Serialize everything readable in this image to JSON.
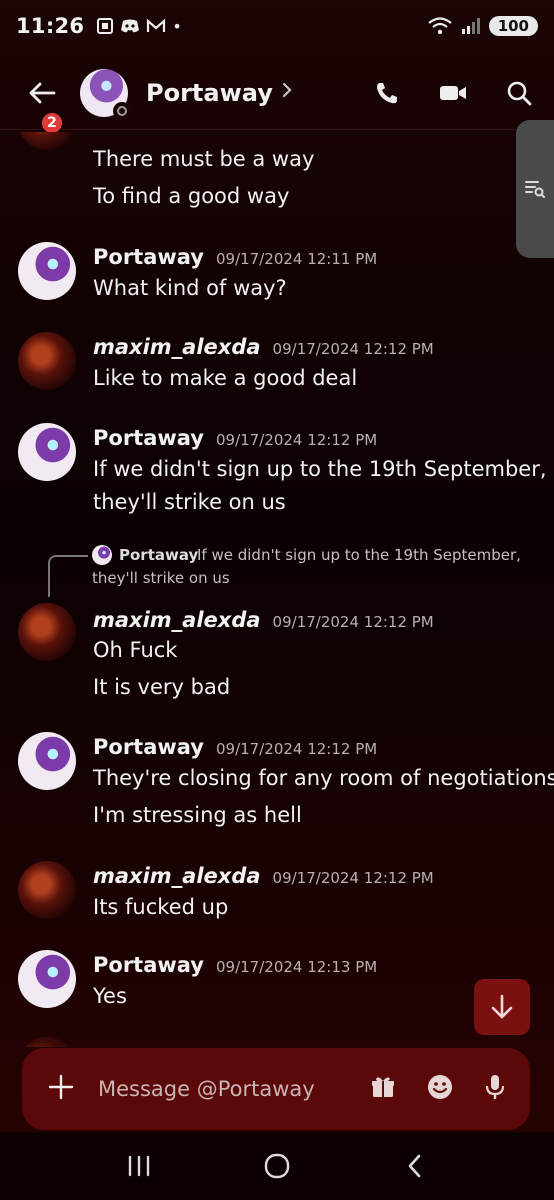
{
  "status": {
    "time": "11:26",
    "battery": "100",
    "network": "6"
  },
  "header": {
    "title": "Portaway",
    "unread_badge": "2"
  },
  "messages": [
    {
      "type": "continuation",
      "lines": [
        "There must be a way",
        "To find a good way"
      ]
    },
    {
      "author": "Portaway",
      "timestamp": "09/17/2024 12:11 PM",
      "lines": [
        "What kind of way?"
      ]
    },
    {
      "author": "maxim_alexda",
      "timestamp": "09/17/2024 12:12 PM",
      "lines": [
        "Like to make a good deal"
      ]
    },
    {
      "author": "Portaway",
      "timestamp": "09/17/2024 12:12 PM",
      "lines": [
        "If we didn't sign up to the 19th September,",
        "they'll strike on us"
      ]
    },
    {
      "author": "maxim_alexda",
      "timestamp": "09/17/2024 12:12 PM",
      "reply": {
        "author": "Portaway",
        "text_line1": "If we didn't sign up to the 19th September,",
        "text_line2": "they'll strike on us"
      },
      "lines": [
        "Oh Fuck",
        "It is very bad"
      ]
    },
    {
      "author": "Portaway",
      "timestamp": "09/17/2024 12:12 PM",
      "lines": [
        "They're closing for any room of negotiations",
        "I'm stressing as hell"
      ]
    },
    {
      "author": "maxim_alexda",
      "timestamp": "09/17/2024 12:12 PM",
      "lines": [
        "Its fucked up"
      ]
    },
    {
      "author": "Portaway",
      "timestamp": "09/17/2024 12:13 PM",
      "lines": [
        "Yes"
      ]
    }
  ],
  "composer": {
    "placeholder": "Message @Portaway"
  },
  "colors": {
    "accent": "#7a1010",
    "composer_bg": "#5a0808",
    "badge": "#e03a3a"
  }
}
